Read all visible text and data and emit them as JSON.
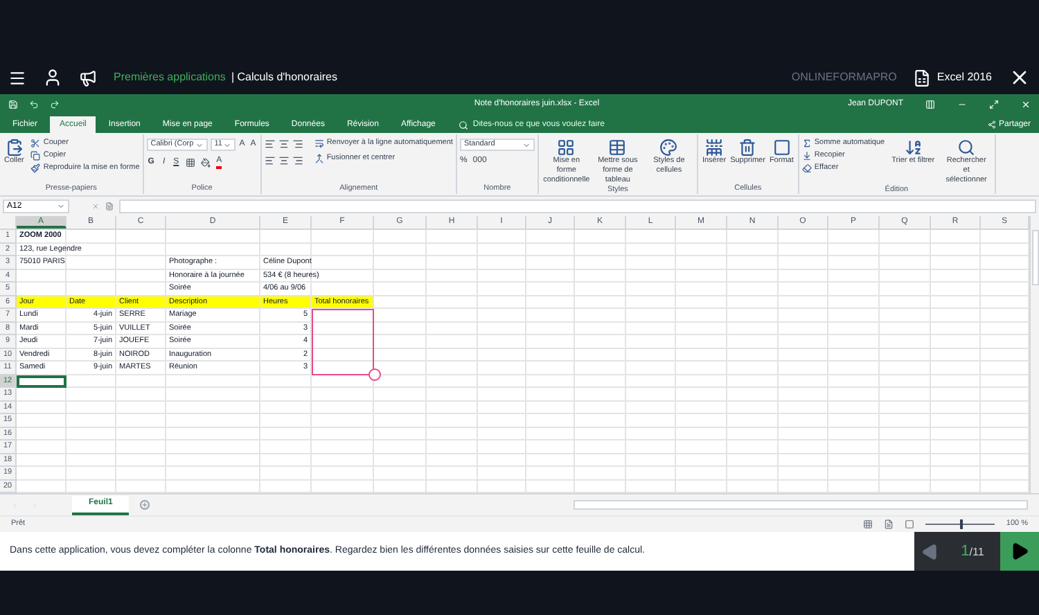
{
  "app_bar": {
    "course": "Premières applications",
    "lesson": "| Calculs d'honoraires",
    "brand": "ONLINEFORMAPRO",
    "product": "Excel 2016"
  },
  "excel": {
    "file_title": "Note d'honoraires juin.xlsx - Excel",
    "user": "Jean DUPONT",
    "tabs": [
      {
        "label": "Fichier",
        "selected": false
      },
      {
        "label": "Accueil",
        "selected": true
      },
      {
        "label": "Insertion",
        "selected": false
      },
      {
        "label": "Mise en page",
        "selected": false
      },
      {
        "label": "Formules",
        "selected": false
      },
      {
        "label": "Données",
        "selected": false
      },
      {
        "label": "Révision",
        "selected": false
      },
      {
        "label": "Affichage",
        "selected": false
      }
    ],
    "search": {
      "placeholder": "Dites-nous ce que vous voulez faire"
    },
    "share": "Partager",
    "ribbon_groups": [
      {
        "kind": "clipboard",
        "label": "Presse-papiers",
        "large": [
          {
            "label": "Coller"
          }
        ],
        "small": [
          {
            "label": "Couper"
          },
          {
            "label": "Copier"
          },
          {
            "label": "Reproduire la mise en forme"
          }
        ]
      },
      {
        "kind": "font",
        "label": "Police",
        "fields": [
          {
            "value": "Calibri (Corp"
          },
          {
            "value": "11"
          }
        ],
        "size_buttons": [
          "A",
          "A"
        ],
        "format_buttons": [
          "G",
          "I",
          "S"
        ],
        "color_button": "A"
      },
      {
        "kind": "alignment",
        "label": "Alignement",
        "small": [
          {
            "label": "Renvoyer à la ligne automatiquement"
          },
          {
            "label": "Fusionner et centrer"
          }
        ]
      },
      {
        "kind": "number",
        "label": "Nombre",
        "fields": [
          {
            "value": "Standard"
          }
        ],
        "symbols": [
          "%",
          "000"
        ]
      },
      {
        "kind": "large",
        "label": "Styles",
        "large": [
          {
            "label": "Mise en forme conditionnelle"
          },
          {
            "label": "Mettre sous forme de tableau"
          },
          {
            "label": "Styles de cellules"
          }
        ]
      },
      {
        "kind": "large",
        "label": "Cellules",
        "large": [
          {
            "label": "Insérer"
          },
          {
            "label": "Supprimer"
          },
          {
            "label": "Format"
          }
        ]
      },
      {
        "kind": "editing",
        "label": "Édition",
        "small": [
          {
            "label": "Somme automatique"
          },
          {
            "label": "Recopier"
          },
          {
            "label": "Effacer"
          }
        ],
        "large": [
          {
            "label": "Trier et filtrer"
          },
          {
            "label": "Rechercher et sélectionner"
          }
        ]
      }
    ],
    "name_box": "A12",
    "columns": [
      {
        "label": "A",
        "selected": true,
        "highlighted": false
      },
      {
        "label": "B",
        "selected": false,
        "highlighted": false
      },
      {
        "label": "C",
        "selected": false,
        "highlighted": false
      },
      {
        "label": "D",
        "selected": false,
        "highlighted": false
      },
      {
        "label": "E",
        "selected": false,
        "highlighted": false
      },
      {
        "label": "F",
        "selected": false,
        "highlighted": true
      },
      {
        "label": "G",
        "selected": false,
        "highlighted": false
      },
      {
        "label": "H",
        "selected": false,
        "highlighted": false
      },
      {
        "label": "I",
        "selected": false,
        "highlighted": false
      },
      {
        "label": "J",
        "selected": false,
        "highlighted": false
      },
      {
        "label": "K",
        "selected": false,
        "highlighted": false
      },
      {
        "label": "L",
        "selected": false,
        "highlighted": false
      },
      {
        "label": "M",
        "selected": false,
        "highlighted": false
      },
      {
        "label": "N",
        "selected": false,
        "highlighted": false
      },
      {
        "label": "O",
        "selected": false,
        "highlighted": false
      },
      {
        "label": "P",
        "selected": false,
        "highlighted": false
      },
      {
        "label": "Q",
        "selected": false,
        "highlighted": false
      },
      {
        "label": "R",
        "selected": false,
        "highlighted": false
      },
      {
        "label": "S",
        "selected": false,
        "highlighted": false
      }
    ],
    "rows": [
      {
        "number": "1",
        "selected": false,
        "highlighted": false,
        "cells": {
          "A": {
            "text": "ZOOM 2000",
            "kind": "title"
          }
        }
      },
      {
        "number": "2",
        "selected": false,
        "highlighted": false,
        "cells": {
          "A": {
            "text": "123, rue Legendre",
            "kind": "text"
          }
        }
      },
      {
        "number": "3",
        "selected": false,
        "highlighted": false,
        "cells": {
          "A": {
            "text": "75010 PARIS",
            "kind": "text"
          },
          "D": {
            "text": "Photographe :",
            "kind": "text"
          },
          "E": {
            "text": "Céline Dupont",
            "kind": "text"
          }
        }
      },
      {
        "number": "4",
        "selected": false,
        "highlighted": false,
        "cells": {
          "D": {
            "text": "Honoraire à la journée",
            "kind": "text"
          },
          "E": {
            "text": "534 € (8 heures)",
            "kind": "text"
          }
        }
      },
      {
        "number": "5",
        "selected": false,
        "highlighted": false,
        "cells": {
          "D": {
            "text": "Soirée",
            "kind": "text"
          },
          "E": {
            "text": "4/06 au 9/06",
            "kind": "text"
          }
        }
      },
      {
        "number": "6",
        "selected": false,
        "highlighted": false,
        "cells": {
          "A": {
            "text": "Jour",
            "kind": "header"
          },
          "B": {
            "text": "Date",
            "kind": "header"
          },
          "C": {
            "text": "Client",
            "kind": "header"
          },
          "D": {
            "text": "Description",
            "kind": "header"
          },
          "E": {
            "text": "Heures",
            "kind": "header"
          },
          "F": {
            "text": "Total honoraires",
            "kind": "header"
          }
        }
      },
      {
        "number": "7",
        "selected": false,
        "highlighted": true,
        "cells": {
          "A": {
            "text": "Lundi",
            "kind": "text"
          },
          "B": {
            "text": "4-juin",
            "kind": "number"
          },
          "C": {
            "text": "SERRE",
            "kind": "text"
          },
          "D": {
            "text": "Mariage",
            "kind": "text"
          },
          "E": {
            "text": "5",
            "kind": "number"
          }
        }
      },
      {
        "number": "8",
        "selected": false,
        "highlighted": true,
        "cells": {
          "A": {
            "text": "Mardi",
            "kind": "text"
          },
          "B": {
            "text": "5-juin",
            "kind": "number"
          },
          "C": {
            "text": "VUILLET",
            "kind": "text"
          },
          "D": {
            "text": "Soirée",
            "kind": "text"
          },
          "E": {
            "text": "3",
            "kind": "number"
          }
        }
      },
      {
        "number": "9",
        "selected": false,
        "highlighted": true,
        "cells": {
          "A": {
            "text": "Jeudi",
            "kind": "text"
          },
          "B": {
            "text": "7-juin",
            "kind": "number"
          },
          "C": {
            "text": "JOUEFE",
            "kind": "text"
          },
          "D": {
            "text": "Soirée",
            "kind": "text"
          },
          "E": {
            "text": "4",
            "kind": "number"
          }
        }
      },
      {
        "number": "10",
        "selected": false,
        "highlighted": true,
        "cells": {
          "A": {
            "text": "Vendredi",
            "kind": "text"
          },
          "B": {
            "text": "8-juin",
            "kind": "number"
          },
          "C": {
            "text": "NOIROD",
            "kind": "text"
          },
          "D": {
            "text": "Inauguration",
            "kind": "text"
          },
          "E": {
            "text": "2",
            "kind": "number"
          }
        }
      },
      {
        "number": "11",
        "selected": false,
        "highlighted": true,
        "cells": {
          "A": {
            "text": "Samedi",
            "kind": "text"
          },
          "B": {
            "text": "9-juin",
            "kind": "number"
          },
          "C": {
            "text": "MARTES",
            "kind": "text"
          },
          "D": {
            "text": "Réunion",
            "kind": "text"
          },
          "E": {
            "text": "3",
            "kind": "number"
          }
        }
      },
      {
        "number": "12",
        "selected": true,
        "highlighted": false
      },
      {
        "number": "13",
        "selected": false,
        "highlighted": false
      },
      {
        "number": "14",
        "selected": false,
        "highlighted": false
      },
      {
        "number": "15",
        "selected": false,
        "highlighted": false
      },
      {
        "number": "16",
        "selected": false,
        "highlighted": false
      },
      {
        "number": "17",
        "selected": false,
        "highlighted": false
      },
      {
        "number": "18",
        "selected": false,
        "highlighted": false
      },
      {
        "number": "19",
        "selected": false,
        "highlighted": false
      },
      {
        "number": "20",
        "selected": false,
        "highlighted": false
      }
    ],
    "sheets": [
      {
        "label": "Feuil1",
        "selected": true
      }
    ],
    "status": "Prêt",
    "zoom": {
      "level": 0.5,
      "reading": "100 %"
    }
  },
  "instruction": {
    "text": "Dans cette application, vous devez compléter la colonne **Total honoraires**. Regardez bien les différentes données saisies sur cette feuille de calcul.",
    "current": "1",
    "total": "/11"
  }
}
